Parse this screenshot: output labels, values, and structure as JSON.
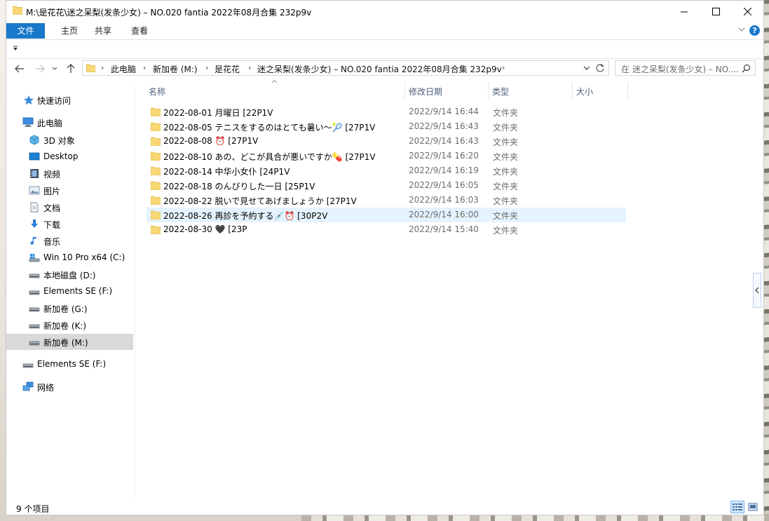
{
  "window": {
    "title": "M:\\是花花\\迷之呆梨(发条少女) – NO.020 fantia 2022年08月合集 232p9v"
  },
  "ribbon": {
    "tabs": [
      "文件",
      "主页",
      "共享",
      "查看"
    ],
    "help": "?"
  },
  "nav": {
    "breadcrumbs": [
      "此电脑",
      "新加卷 (M:)",
      "是花花",
      "迷之呆梨(发条少女) – NO.020 fantia 2022年08月合集 232p9v"
    ],
    "search_placeholder": "在 迷之呆梨(发条少女) – NO...."
  },
  "sidebar": {
    "items": [
      {
        "label": "快速访问",
        "icon": "star-icon"
      },
      {
        "label": "此电脑",
        "icon": "computer-icon"
      },
      {
        "label": "3D 对象",
        "icon": "cube-3d-icon"
      },
      {
        "label": "Desktop",
        "icon": "desktop-icon"
      },
      {
        "label": "视频",
        "icon": "video-icon"
      },
      {
        "label": "图片",
        "icon": "pictures-icon"
      },
      {
        "label": "文档",
        "icon": "documents-icon"
      },
      {
        "label": "下载",
        "icon": "download-icon"
      },
      {
        "label": "音乐",
        "icon": "music-icon"
      },
      {
        "label": "Win 10 Pro x64 (C:)",
        "icon": "windows-drive-icon"
      },
      {
        "label": "本地磁盘 (D:)",
        "icon": "drive-icon"
      },
      {
        "label": "Elements SE (F:)",
        "icon": "drive-icon"
      },
      {
        "label": "新加卷 (G:)",
        "icon": "drive-icon"
      },
      {
        "label": "新加卷 (K:)",
        "icon": "drive-icon"
      },
      {
        "label": "新加卷 (M:)",
        "icon": "drive-icon"
      },
      {
        "label": "Elements SE (F:)",
        "icon": "drive-icon"
      },
      {
        "label": "网络",
        "icon": "network-icon"
      }
    ]
  },
  "columns": {
    "name": "名称",
    "date": "修改日期",
    "type": "类型",
    "size": "大小"
  },
  "files": [
    {
      "name": "2022-08-01 月曜日 [22P1V",
      "date": "2022/9/14 16:44",
      "type": "文件夹"
    },
    {
      "name": "2022-08-05 テニスをするのはとても暑い～🎾 [27P1V",
      "date": "2022/9/14 16:43",
      "type": "文件夹"
    },
    {
      "name": "2022-08-08 ⏰ [27P1V",
      "date": "2022/9/14 16:43",
      "type": "文件夹"
    },
    {
      "name": "2022-08-10 あの、どこが具合が悪いですか💊 [27P1V",
      "date": "2022/9/14 16:20",
      "type": "文件夹"
    },
    {
      "name": "2022-08-14 中华小女仆 [24P1V",
      "date": "2022/9/14 16:19",
      "type": "文件夹"
    },
    {
      "name": "2022-08-18 のんびりした一日 [25P1V",
      "date": "2022/9/14 16:05",
      "type": "文件夹"
    },
    {
      "name": "2022-08-22 脱いで見せてあげましょうか [27P1V",
      "date": "2022/9/14 16:03",
      "type": "文件夹"
    },
    {
      "name": "2022-08-26 再診を予約する💉⏰ [30P2V",
      "date": "2022/9/14 16:00",
      "type": "文件夹"
    },
    {
      "name": "2022-08-30 🖤 [23P",
      "date": "2022/9/14 15:40",
      "type": "文件夹"
    }
  ],
  "status": {
    "count": "9 个项目"
  },
  "colors": {
    "accent": "#1979ca",
    "folder": "#f8d775",
    "selection": "#e5f3ff",
    "sidebar_selected": "#d9d9d9"
  }
}
